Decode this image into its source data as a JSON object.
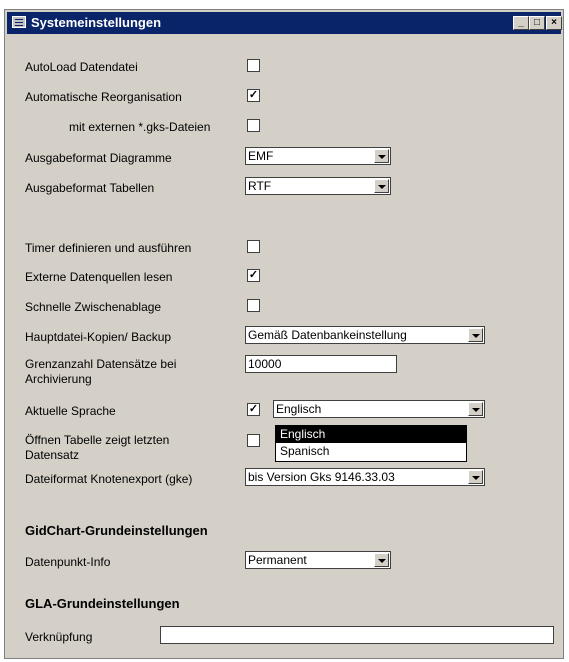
{
  "window": {
    "title": "Systemeinstellungen"
  },
  "titlebar_buttons": {
    "minimize": "_",
    "maximize": "□",
    "close": "×"
  },
  "rows": {
    "autoload": {
      "label": "AutoLoad Datendatei",
      "checked": false
    },
    "reorg": {
      "label": "Automatische Reorganisation",
      "checked": true
    },
    "gks": {
      "label": "mit externen *.gks-Dateien",
      "checked": false
    },
    "ausgabe_diag": {
      "label": "Ausgabeformat Diagramme",
      "value": "EMF"
    },
    "ausgabe_tab": {
      "label": "Ausgabeformat Tabellen",
      "value": "RTF"
    },
    "timer": {
      "label": "Timer definieren und ausführen",
      "checked": false
    },
    "extern": {
      "label": "Externe Datenquellen lesen",
      "checked": true
    },
    "zwischen": {
      "label": "Schnelle Zwischenablage",
      "checked": false
    },
    "backup": {
      "label": "Hauptdatei-Kopien/ Backup",
      "value": "Gemäß Datenbankeinstellung"
    },
    "grenz": {
      "label_1": "Grenzanzahl Datensätze bei",
      "label_2": "Archivierung",
      "value": "10000"
    },
    "sprache": {
      "label": "Aktuelle Sprache",
      "checked": true,
      "value": "Englisch",
      "options": [
        "Englisch",
        "Spanisch"
      ]
    },
    "oeffnen": {
      "label_1": "Öffnen Tabelle zeigt letzten",
      "label_2": "Datensatz",
      "checked": false
    },
    "knoten": {
      "label": "Dateiformat Knotenexport (gke)",
      "value": "bis Version Gks 9146.33.03"
    }
  },
  "gidchart": {
    "heading": "GidChart-Grundeinstellungen",
    "datenpunkt_label": "Datenpunkt-Info",
    "datenpunkt_value": "Permanent"
  },
  "gla": {
    "heading": "GLA-Grundeinstellungen",
    "verknuepfung_label": "Verknüpfung",
    "verknuepfung_value": ""
  },
  "check_glyph": "✓"
}
